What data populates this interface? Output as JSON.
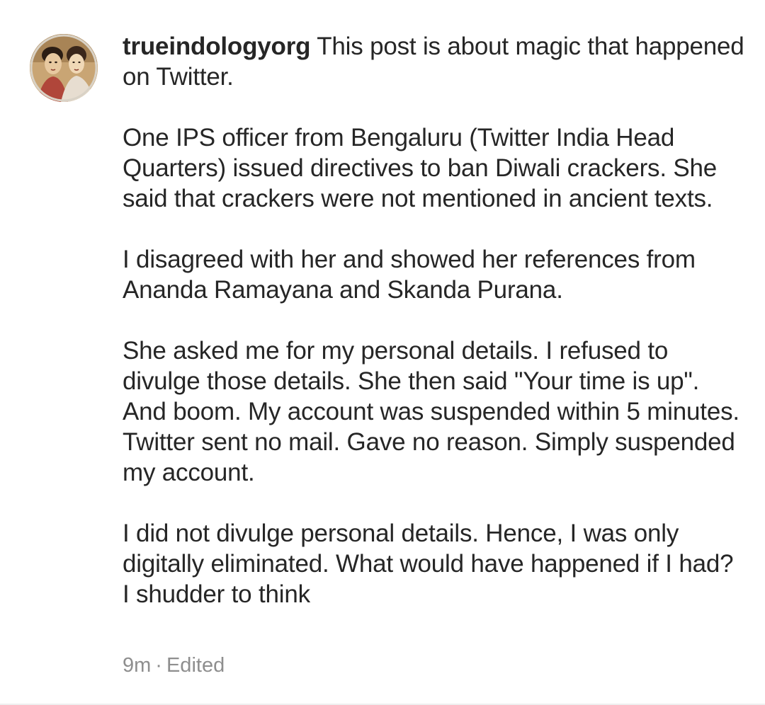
{
  "comment": {
    "username": "trueindologyorg",
    "paragraphs": [
      "This post is about magic that happened on Twitter.",
      "One IPS officer from Bengaluru (Twitter India Head Quarters) issued directives to ban Diwali crackers. She said that crackers were not mentioned in ancient texts.",
      "I disagreed with her and showed her references from Ananda Ramayana and Skanda Purana.",
      "She asked me for my personal details. I refused to divulge those details. She then said \"Your time is up\". And boom. My account was suspended within 5 minutes. Twitter sent no mail. Gave no reason. Simply suspended my account.",
      "I did not divulge personal details. Hence, I was only digitally eliminated. What would have happened if I had?  I shudder to think"
    ],
    "time": "9m",
    "separator": "·",
    "edited_label": "Edited"
  },
  "avatar": {
    "icon": "profile-avatar-painting-icon",
    "colors": {
      "background": "#c9a574",
      "skin": "#e8c9a0",
      "hair": "#2b1d14",
      "robe": "#b0463a",
      "ring": "#d9d2c6"
    }
  },
  "theme": {
    "text": "#262626",
    "muted": "#8e8e8e",
    "divider": "#efefef"
  }
}
